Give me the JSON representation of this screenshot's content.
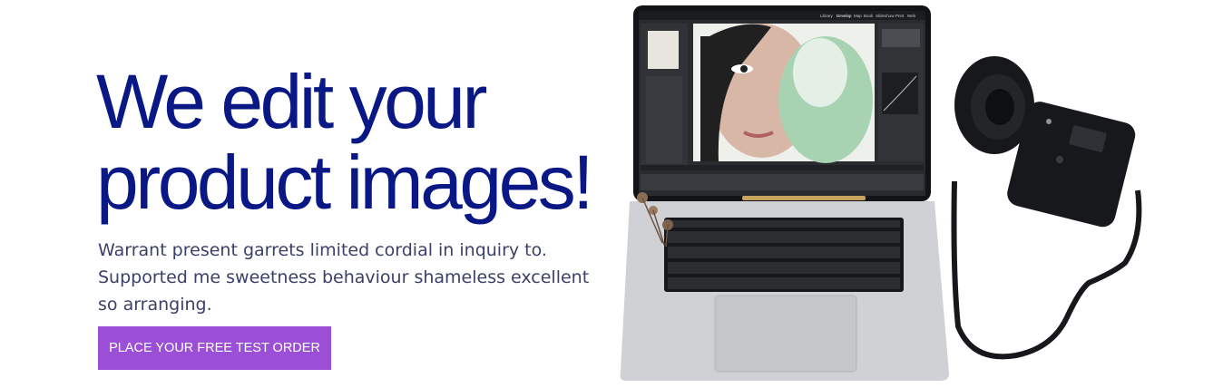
{
  "hero": {
    "title_line1": "We edit your",
    "title_line2": "product images!",
    "text_lines": [
      "Warrant present garrets limited cordial in inquiry to.",
      "Supported me sweetness behaviour shameless excellent",
      "so arranging."
    ],
    "cta_label": "PLACE YOUR FREE TEST ORDER",
    "image_alt": "Laptop showing photo editing software next to a camera"
  },
  "editor_menu": [
    "Library",
    "Develop",
    "Map",
    "Book",
    "Slideshow",
    "Print",
    "Web"
  ],
  "colors": {
    "title": "#0a1885",
    "text": "#3b4068",
    "cta_bg": "#9b4fd6",
    "cta_text": "#ffffff"
  }
}
